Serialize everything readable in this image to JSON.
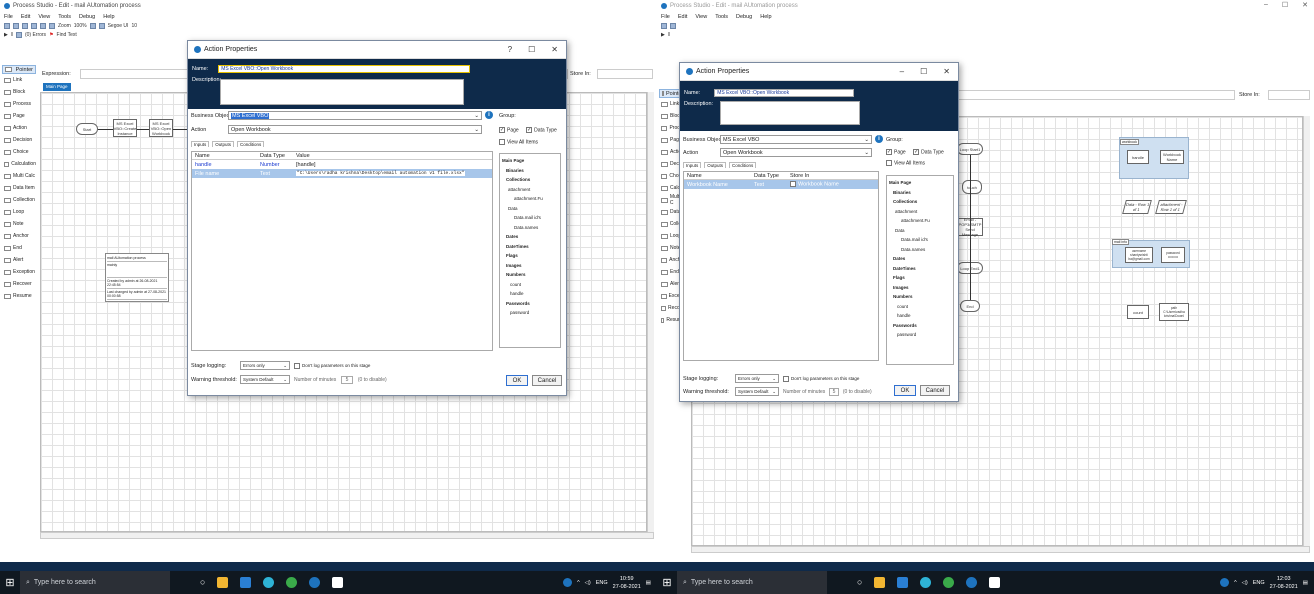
{
  "app": {
    "title": "Process Studio - Edit - mail AUtomation process",
    "menu": [
      "File",
      "Edit",
      "View",
      "Tools",
      "Debug",
      "Help"
    ],
    "zoom_label": "Zoom",
    "zoom_value": "100%",
    "font_name": "Segoe UI",
    "font_size": "10",
    "errors_label": "(0) Errors",
    "find_text_label": "Find Text",
    "expression_label": "Expression:",
    "store_in_label": "Store In:",
    "page_tab": "Main Page",
    "toolbox": [
      "Pointer",
      "Link",
      "Block",
      "Process",
      "Page",
      "Action",
      "Decision",
      "Choice",
      "Calculation",
      "Multi Calc",
      "Data Item",
      "Collection",
      "Loop",
      "Note",
      "Anchor",
      "End",
      "Alert",
      "Exception",
      "Recover",
      "Resume"
    ],
    "toolbox_short": [
      "Pointer",
      "Link",
      "Block",
      "Proces",
      "Page",
      "Action",
      "Decisi",
      "Choice",
      "Calcul",
      "Multi C",
      "Data It",
      "Collect",
      "Loop",
      "Note",
      "Anchor",
      "End",
      "Alert",
      "Excepti",
      "Recove",
      "Resume"
    ]
  },
  "left_canvas": {
    "start": "Start",
    "actions": [
      "MS Excel VBO::Create Instance",
      "MS Excel VBO::Open Workbook"
    ],
    "info_box": {
      "title": "mail AUtomation process",
      "desc": "mainly",
      "created": "Created by admin at 26-08-2021 22:45:54",
      "changed": "Last changed by admin at 27-08-2021 00:00:58"
    }
  },
  "right_canvas": {
    "shapes": [
      "Loop Start1",
      "touch",
      "Email - POP3/SMTP Send Message",
      "Loop End1",
      "End"
    ],
    "data_items": [
      "workbook",
      "handle",
      "Workbook Name",
      "Data - Row 1 of 1",
      "attachment - Row 1 of 1",
      "mail info",
      "username",
      "password",
      "shantysrishti ba@gmail.com",
      "count",
      "path",
      "C:\\Users\\radha krishna\\Downl"
    ]
  },
  "dialog": {
    "title": "Action Properties",
    "name_label": "Name:",
    "name_value": "MS Excel VBO::Open Workbook",
    "description_label": "Description:",
    "business_object_label": "Business Object:",
    "business_object_value": "MS Excel VBO",
    "action_label": "Action",
    "action_value": "Open Workbook",
    "tabs": [
      "Inputs",
      "Outputs",
      "Conditions"
    ],
    "group_label": "Group:",
    "page_label": "Page",
    "data_type_label": "Data Type",
    "view_all_label": "View All Items",
    "left_table": {
      "headers": [
        "Name",
        "Data Type",
        "Value"
      ],
      "rows": [
        [
          "handle",
          "Number",
          "[handle]"
        ],
        [
          "File name",
          "Text",
          "\"C:\\Users\\radha krishna\\Desktop\\email automation v1 file.xlsx\""
        ]
      ]
    },
    "right_table": {
      "headers": [
        "Name",
        "Data Type",
        "Store In"
      ],
      "rows": [
        [
          "Workbook Name",
          "Text",
          "Workbook Name"
        ]
      ]
    },
    "tree": [
      "Main Page",
      "Binaries",
      "Collections",
      "attachment",
      "attachment.Fu",
      "Data",
      "Data.mail id's",
      "Data.names",
      "Dates",
      "DateTimes",
      "Flags",
      "Images",
      "Numbers",
      "count",
      "handle",
      "Passwords",
      "password"
    ],
    "stage_logging_label": "Stage logging:",
    "stage_logging_value": "Errors only",
    "dont_log_label": "Don't log parameters on this stage",
    "warning_label": "Warning threshold:",
    "warning_value": "System Default",
    "minutes_label": "Number of minutes",
    "minutes_value": "5",
    "disable_hint": "(0 to disable)",
    "ok_label": "OK",
    "cancel_label": "Cancel",
    "help_label": "?"
  },
  "taskbar": {
    "search_placeholder": "Type here to search",
    "lang": "ENG",
    "left_time": "10:59",
    "left_date": "27-08-2021",
    "right_time": "12:03",
    "right_date": "27-08-2021"
  }
}
